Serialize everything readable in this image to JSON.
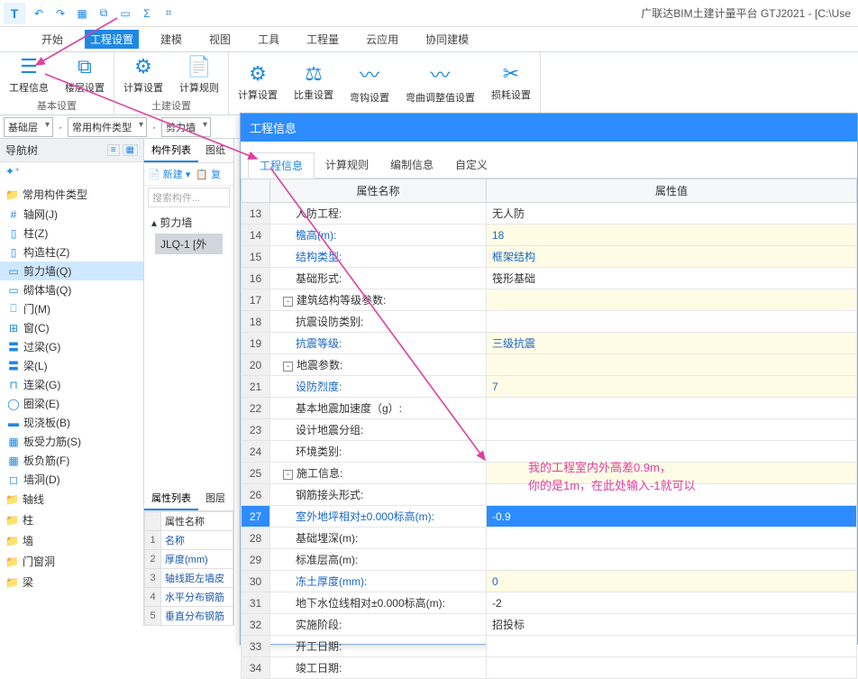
{
  "app": {
    "title": "广联达BIM土建计量平台 GTJ2021 - [C:\\Use",
    "logo": "T"
  },
  "qat": [
    "↶",
    "↷",
    "▦",
    "⧉",
    "▭",
    "Σ",
    "⌗"
  ],
  "menu": {
    "items": [
      "开始",
      "工程设置",
      "建模",
      "视图",
      "工具",
      "工程量",
      "云应用",
      "协同建模"
    ],
    "active": 1
  },
  "ribbon": {
    "groups": [
      {
        "label": "基本设置",
        "buttons": [
          {
            "icon": "☰",
            "label": "工程信息"
          },
          {
            "icon": "⧉",
            "label": "楼层设置"
          }
        ]
      },
      {
        "label": "土建设置",
        "buttons": [
          {
            "icon": "⚙",
            "label": "计算设置"
          },
          {
            "icon": "📄",
            "label": "计算规则"
          }
        ]
      },
      {
        "label": "",
        "buttons": [
          {
            "icon": "⚙",
            "label": "计算设置"
          },
          {
            "icon": "⚖",
            "label": "比重设置"
          },
          {
            "icon": "〰",
            "label": "弯钩设置"
          },
          {
            "icon": "〰",
            "label": "弯曲调整值设置"
          },
          {
            "icon": "✂",
            "label": "损耗设置"
          }
        ]
      }
    ]
  },
  "filters": {
    "layer": "基础层",
    "type": "常用构件类型",
    "comp": "剪力墙"
  },
  "nav": {
    "title": "导航树",
    "cats": [
      {
        "label": "常用构件类型",
        "icon": "📁",
        "children": [
          {
            "icon": "#",
            "label": "轴网(J)"
          },
          {
            "icon": "▯",
            "label": "柱(Z)"
          },
          {
            "icon": "▯",
            "label": "构造柱(Z)"
          },
          {
            "icon": "▭",
            "label": "剪力墙(Q)",
            "sel": true
          },
          {
            "icon": "▭",
            "label": "砌体墙(Q)"
          },
          {
            "icon": "⎕",
            "label": "门(M)"
          },
          {
            "icon": "⊞",
            "label": "窗(C)"
          },
          {
            "icon": "〓",
            "label": "过梁(G)"
          },
          {
            "icon": "〓",
            "label": "梁(L)"
          },
          {
            "icon": "⊓",
            "label": "连梁(G)"
          },
          {
            "icon": "◯",
            "label": "圈梁(E)"
          },
          {
            "icon": "▬",
            "label": "现浇板(B)"
          },
          {
            "icon": "▦",
            "label": "板受力筋(S)"
          },
          {
            "icon": "▦",
            "label": "板负筋(F)"
          },
          {
            "icon": "◻",
            "label": "墙洞(D)"
          }
        ]
      },
      {
        "label": "轴线",
        "icon": "📁"
      },
      {
        "label": "柱",
        "icon": "📁"
      },
      {
        "label": "墙",
        "icon": "📁"
      },
      {
        "label": "门窗洞",
        "icon": "📁"
      },
      {
        "label": "梁",
        "icon": "📁"
      }
    ]
  },
  "complist": {
    "tabs": [
      "构件列表",
      "图纸"
    ],
    "new": "新建",
    "copy": "复",
    "search": "搜索构件...",
    "group": "剪力墙",
    "item": "JLQ-1 [外"
  },
  "props": {
    "tabs": [
      "属性列表",
      "图层"
    ],
    "header": "属性名称",
    "rows": [
      {
        "n": "1",
        "name": "名称"
      },
      {
        "n": "2",
        "name": "厚度(mm)"
      },
      {
        "n": "3",
        "name": "轴线距左墙皮"
      },
      {
        "n": "4",
        "name": "水平分布钢筋"
      },
      {
        "n": "5",
        "name": "垂直分布钢筋"
      }
    ]
  },
  "overlay": {
    "title": "工程信息",
    "tabs": [
      "工程信息",
      "计算规则",
      "编制信息",
      "自定义"
    ],
    "headers": {
      "name": "属性名称",
      "value": "属性值"
    },
    "rows": [
      {
        "n": "13",
        "name": "人防工程:",
        "val": "无人防",
        "indent": 2,
        "plain": true
      },
      {
        "n": "14",
        "name": "檐高(m):",
        "val": "18",
        "indent": 2,
        "link": true,
        "vlink": true
      },
      {
        "n": "15",
        "name": "结构类型:",
        "val": "框架结构",
        "indent": 2,
        "link": true,
        "vlink": true
      },
      {
        "n": "16",
        "name": "基础形式:",
        "val": "筏形基础",
        "indent": 2,
        "plain": true
      },
      {
        "n": "17",
        "name": "建筑结构等级参数:",
        "val": "",
        "indent": 1,
        "grp": true,
        "exp": "-"
      },
      {
        "n": "18",
        "name": "抗震设防类别:",
        "val": "",
        "indent": 2,
        "plain": true
      },
      {
        "n": "19",
        "name": "抗震等级:",
        "val": "三级抗震",
        "indent": 2,
        "link": true,
        "vlink": true
      },
      {
        "n": "20",
        "name": "地震参数:",
        "val": "",
        "indent": 1,
        "grp": true,
        "exp": "-"
      },
      {
        "n": "21",
        "name": "设防烈度:",
        "val": "7",
        "indent": 2,
        "link": true,
        "vlink": true
      },
      {
        "n": "22",
        "name": "基本地震加速度（g）:",
        "val": "",
        "indent": 2,
        "plain": true
      },
      {
        "n": "23",
        "name": "设计地震分组:",
        "val": "",
        "indent": 2,
        "plain": true
      },
      {
        "n": "24",
        "name": "环境类别:",
        "val": "",
        "indent": 2,
        "plain": true
      },
      {
        "n": "25",
        "name": "施工信息:",
        "val": "",
        "indent": 1,
        "grp": true,
        "exp": "-"
      },
      {
        "n": "26",
        "name": "钢筋接头形式:",
        "val": "",
        "indent": 2,
        "plain": true
      },
      {
        "n": "27",
        "name": "室外地坪相对±0.000标高(m):",
        "val": "-0.9",
        "indent": 2,
        "link": true,
        "sel": true
      },
      {
        "n": "28",
        "name": "基础埋深(m):",
        "val": "",
        "indent": 2,
        "plain": true
      },
      {
        "n": "29",
        "name": "标准层高(m):",
        "val": "",
        "indent": 2,
        "plain": true
      },
      {
        "n": "30",
        "name": "冻土厚度(mm):",
        "val": "0",
        "indent": 2,
        "link": true,
        "vlink": true
      },
      {
        "n": "31",
        "name": "地下水位线相对±0.000标高(m):",
        "val": "-2",
        "indent": 2,
        "plain": true
      },
      {
        "n": "32",
        "name": "实施阶段:",
        "val": "招投标",
        "indent": 2,
        "plain": true
      },
      {
        "n": "33",
        "name": "开工日期:",
        "val": "",
        "indent": 2,
        "plain": true
      },
      {
        "n": "34",
        "name": "竣工日期:",
        "val": "",
        "indent": 2,
        "plain": true
      }
    ]
  },
  "annotation": {
    "line1": "我的工程室内外高差0.9m，",
    "line2": "你的是1m，在此处输入-1就可以"
  }
}
